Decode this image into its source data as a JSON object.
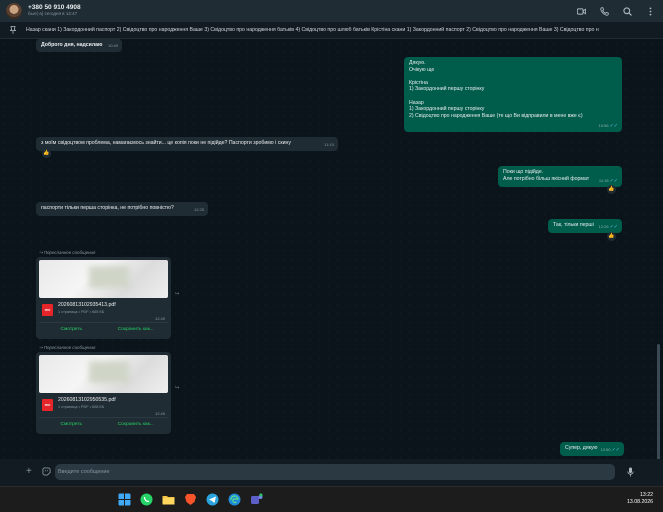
{
  "header": {
    "contact_name": "+380 50 910 4908",
    "contact_status": "был(-а) сегодня в 12:47",
    "icons": [
      "video-icon",
      "phone-icon",
      "search-icon",
      "more-icon"
    ]
  },
  "pinned": {
    "text": "Назар скани 1) Закордонний паспорт 2) Свідоцтво про народження Ваше 3) Свідоцтво про народження батьків 4) Свідоцтво про шлюб батьків Крістіна скани 1) Закордонний паспорт 2) Свідоцтво про народження Ваше 3) Свідоцтво про н"
  },
  "messages": [
    {
      "text": "Доброго дня, надсилаю",
      "time": "10:49"
    },
    {
      "text": "Дякую.\nОчікую ще\n\nКрістіна\n1) Закордонний першу сторінку\n\nНазар\n1) Закордонний першу сторінку\n2) Свідоцтво про народження Ваше (те що Ви відправили в мене вже є)",
      "time": "10:56"
    },
    {
      "text": "з моїм свідоцтвом проблема, намагаємось знайти... це копія поки не підійде? Паспорти зробимо і скину",
      "time": "11:10",
      "reaction": "👍"
    },
    {
      "text": "Поки що підійде.\nАле потрібно більш якісний формат",
      "time": "11:18",
      "reaction": "👍"
    },
    {
      "text": "паспорти тільки перша сторінка, не потрібно повністю?",
      "time": "12:25"
    },
    {
      "text": "Так, тільки перші",
      "time": "12:26",
      "reaction": "👍"
    },
    {
      "text": "Супер, дякую",
      "time": "12:50"
    }
  ],
  "forwarded": [
    {
      "label": "Пересланное сообщение",
      "file_name": "20260813102935413.pdf",
      "file_meta": "1 страница • PDF • 665 КБ",
      "time": "12:45",
      "open_label": "Смотреть",
      "save_label": "Сохранить как...",
      "badge": "PDF"
    },
    {
      "label": "Пересланное сообщение",
      "file_name": "20260813102950535.pdf",
      "file_meta": "1 страница • PDF • 608 КБ",
      "time": "12:45",
      "open_label": "Смотреть",
      "save_label": "Сохранить как...",
      "badge": "PDF"
    }
  ],
  "composer": {
    "placeholder": "Введите сообщение"
  },
  "taskbar": {
    "apps": [
      "windows-start",
      "whatsapp",
      "file-explorer",
      "brave",
      "telegram",
      "edge",
      "teams"
    ],
    "time": "13:22",
    "date": "13.08.2026"
  },
  "colors": {
    "incoming": "#202c33",
    "outgoing": "#005c4b",
    "accent": "#25d366",
    "read_tick": "#53bdeb"
  }
}
